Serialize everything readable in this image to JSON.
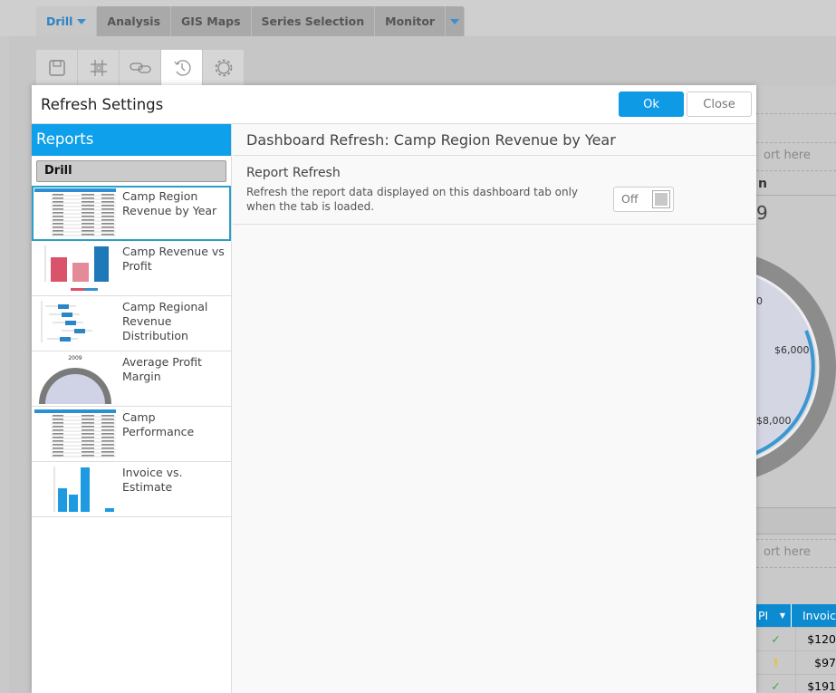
{
  "tabs": [
    {
      "label": "Drill",
      "active": true
    },
    {
      "label": "Analysis"
    },
    {
      "label": "GIS Maps"
    },
    {
      "label": "Series Selection"
    },
    {
      "label": "Monitor"
    }
  ],
  "toolbar": [
    {
      "icon": "save-icon"
    },
    {
      "icon": "grid-icon"
    },
    {
      "icon": "link-icon"
    },
    {
      "icon": "history-icon",
      "active": true
    },
    {
      "icon": "gear-icon"
    }
  ],
  "modal": {
    "title": "Refresh Settings",
    "ok_label": "Ok",
    "close_label": "Close",
    "reports_header": "Reports",
    "category": "Drill",
    "reports": [
      {
        "name": "Camp Region Revenue by Year",
        "selected": true,
        "thumb": "table"
      },
      {
        "name": "Camp Revenue vs Profit",
        "thumb": "bar"
      },
      {
        "name": "Camp Regional Revenue Distribution",
        "thumb": "boxplot"
      },
      {
        "name": "Average Profit Margin",
        "thumb": "gauge",
        "thumb_label": "2009"
      },
      {
        "name": "Camp Performance",
        "thumb": "table"
      },
      {
        "name": "Invoice vs. Estimate",
        "thumb": "bar-blue"
      }
    ],
    "detail_title": "Dashboard Refresh: Camp Region Revenue by Year",
    "section_title": "Report Refresh",
    "section_desc": "Refresh the report data displayed on this dashboard tab only when the tab is loaded.",
    "toggle_label": "Off",
    "toggle_on": false
  },
  "background": {
    "drop_text_1": "ort here",
    "heading_fragment": "n",
    "year_fragment": "9",
    "gauge_labels": [
      "0",
      "$6,000",
      "$8,000"
    ],
    "drop_text_2": "ort here",
    "table": {
      "headers": [
        "PI",
        "Invoic"
      ],
      "rows": [
        {
          "status": "check",
          "value": "$120"
        },
        {
          "status": "warning",
          "value": "$97"
        },
        {
          "status": "check",
          "value": "$191"
        }
      ]
    }
  },
  "colors": {
    "accent": "#0ea0ea",
    "check": "#3aa845",
    "warning": "#e8c31c"
  }
}
